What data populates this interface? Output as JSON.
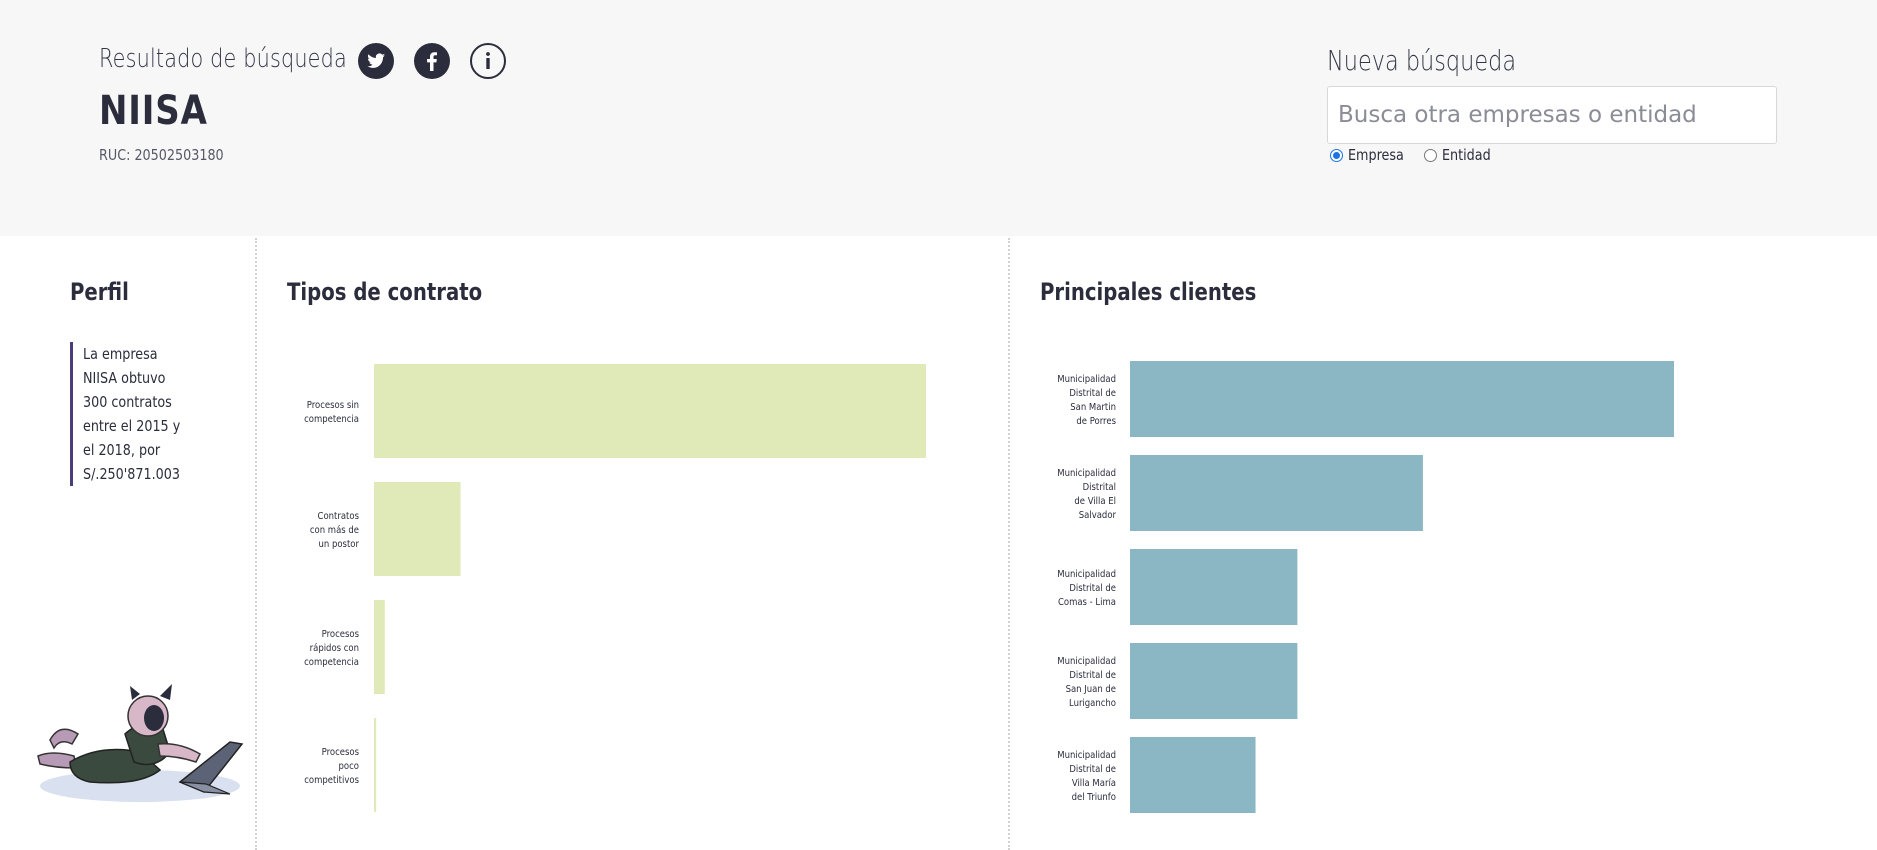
{
  "header": {
    "result_title": "Resultado de búsqueda",
    "company_name": "NIISA",
    "ruc": "RUC: 20502503180",
    "icons": [
      "twitter-icon",
      "facebook-icon",
      "info-icon"
    ]
  },
  "search": {
    "title": "Nueva búsqueda",
    "placeholder": "Busca otra empresas o entidad",
    "options": [
      {
        "label": "Empresa",
        "checked": true
      },
      {
        "label": "Entidad",
        "checked": false
      }
    ]
  },
  "profile": {
    "title": "Perfil",
    "text": "La empresa NIISA obtuvo 300 contratos entre el 2015 y el 2018, por S/.250'871.003"
  },
  "colors": {
    "header_bg": "#f7f7f7",
    "dark": "#2b2d3c",
    "bar_contract": "#e0eab8",
    "bar_client": "#8bb7c4",
    "profile_border": "#4a3d78"
  },
  "chart_data": [
    {
      "type": "bar",
      "title": "Tipos de contrato",
      "orientation": "horizontal",
      "categories": [
        [
          "Procesos sin",
          "competencia"
        ],
        [
          "Contratos",
          "con más de",
          "un postor"
        ],
        [
          "Procesos",
          "rápidos con",
          "competencia"
        ],
        [
          "Procesos",
          "poco",
          "competitivos"
        ]
      ],
      "values": [
        255,
        40,
        5,
        1
      ],
      "xlim": [
        0,
        255
      ],
      "color": "#e0eab8",
      "grid": false
    },
    {
      "type": "bar",
      "title": "Principales clientes",
      "orientation": "horizontal",
      "categories": [
        [
          "Municipalidad",
          "Distrital de",
          "San Martin",
          "de Porres"
        ],
        [
          "Municipalidad",
          "Distrital",
          "de Villa El",
          "Salvador"
        ],
        [
          "Municipalidad",
          "Distrital de",
          "Comas - Lima"
        ],
        [
          "Municipalidad",
          "Distrital de",
          "San Juan de",
          "Lurigancho"
        ],
        [
          "Municipalidad",
          "Distrital de",
          "Villa María",
          "del Triunfo"
        ]
      ],
      "values": [
        13,
        7,
        4,
        4,
        3
      ],
      "xlim": [
        0,
        13
      ],
      "color": "#8bb7c4",
      "grid": false
    }
  ]
}
